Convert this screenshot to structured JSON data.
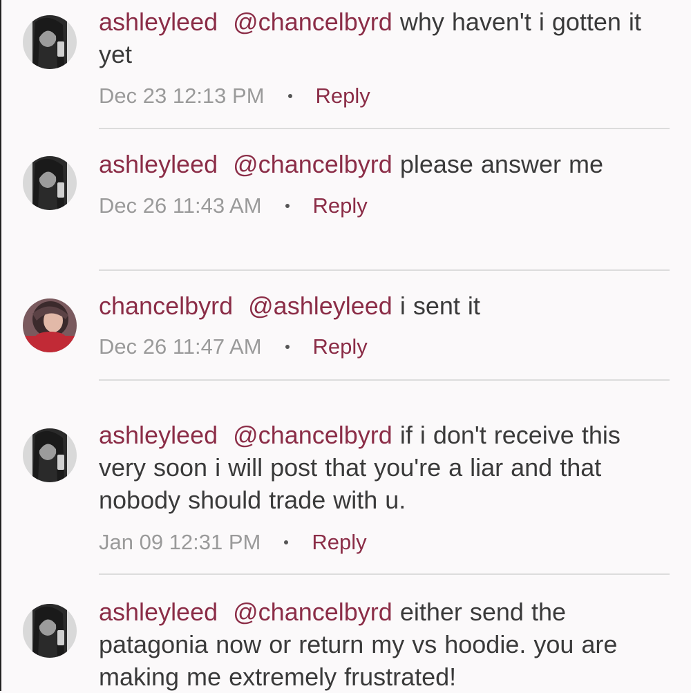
{
  "comments": [
    {
      "username": "ashleyleed",
      "mention": "@chancelbyrd",
      "message": "why haven't i gotten it yet",
      "timestamp": "Dec 23 12:13 PM",
      "reply_label": "Reply",
      "avatar": "grayscale-selfie"
    },
    {
      "username": "ashleyleed",
      "mention": "@chancelbyrd",
      "message": "please answer me",
      "timestamp": "Dec 26 11:43 AM",
      "reply_label": "Reply",
      "avatar": "grayscale-selfie"
    },
    {
      "username": "chancelbyrd",
      "mention": "@ashleyleed",
      "message": "i sent it",
      "timestamp": "Dec 26 11:47 AM",
      "reply_label": "Reply",
      "avatar": "color-portrait-red-shirt"
    },
    {
      "username": "ashleyleed",
      "mention": "@chancelbyrd",
      "message": "if i don't receive this very soon i will post that you're a liar and that nobody should trade with u.",
      "timestamp": "Jan 09 12:31 PM",
      "reply_label": "Reply",
      "avatar": "grayscale-selfie"
    },
    {
      "username": "ashleyleed",
      "mention": "@chancelbyrd",
      "message": "either send the patagonia now or return my vs hoodie. you are making me extremely frustrated!",
      "timestamp": "",
      "reply_label": "",
      "avatar": "grayscale-selfie"
    }
  ],
  "colors": {
    "accent": "#8b2d47",
    "text": "#3a3a3a",
    "meta": "#9a9a9a",
    "divider": "#dcdcdc",
    "background": "#fbf9fa"
  }
}
